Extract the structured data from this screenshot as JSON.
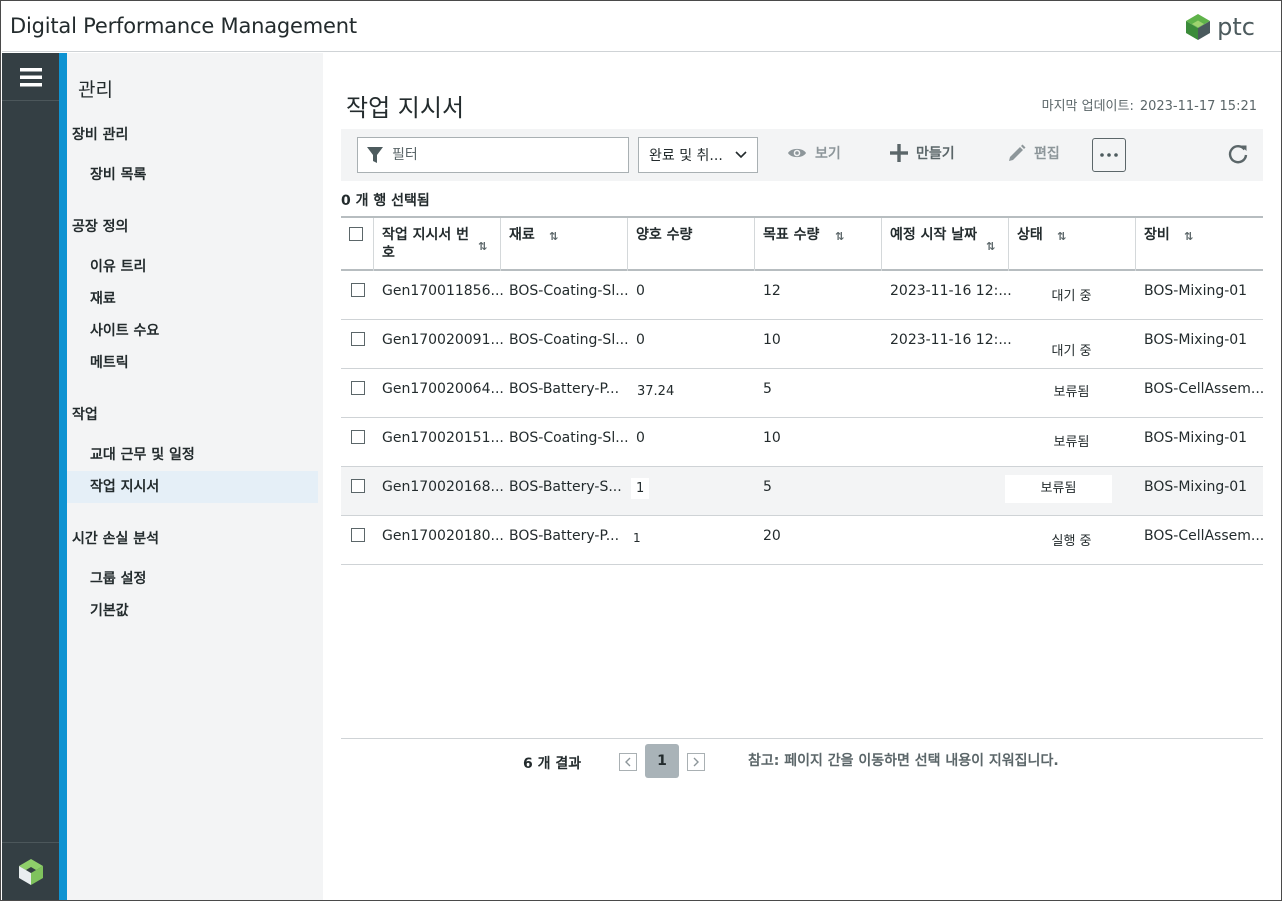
{
  "app": {
    "title": "Digital Performance Management",
    "brand": "ptc"
  },
  "sidebar": {
    "title": "관리",
    "groups": [
      {
        "label": "장비 관리",
        "items": [
          {
            "label": "장비 목록"
          }
        ]
      },
      {
        "label": "공장 정의",
        "items": [
          {
            "label": "이유 트리"
          },
          {
            "label": "재료"
          },
          {
            "label": "사이트 수요"
          },
          {
            "label": "메트릭"
          }
        ]
      },
      {
        "label": "작업",
        "items": [
          {
            "label": "교대 근무 및 일정"
          },
          {
            "label": "작업 지시서"
          }
        ]
      },
      {
        "label": "시간 손실 분석",
        "items": [
          {
            "label": "그룹 설정"
          },
          {
            "label": "기본값"
          }
        ]
      }
    ]
  },
  "page": {
    "title": "작업 지시서",
    "last_update_label": "마지막 업데이트:",
    "last_update_value": "2023-11-17 15:21"
  },
  "toolbar": {
    "filter_placeholder": "필터",
    "select_value": "완료 및 취...",
    "view_label": "보기",
    "create_label": "만들기",
    "edit_label": "편집"
  },
  "selection_text": "0 개 행 선택됨",
  "table": {
    "columns": [
      {
        "label": "작업 지시서 번호"
      },
      {
        "label": "재료"
      },
      {
        "label": "양호 수량"
      },
      {
        "label": "목표 수량"
      },
      {
        "label": "예정 시작 날짜"
      },
      {
        "label": "상태"
      },
      {
        "label": "장비"
      }
    ],
    "rows": [
      {
        "id": "Gen170011856...",
        "material": "BOS-Coating-Sl...",
        "good": "0",
        "target": "12",
        "start": "2023-11-16 12:...",
        "status": "대기 중",
        "equipment": "BOS-Mixing-01"
      },
      {
        "id": "Gen170020091...",
        "material": "BOS-Coating-Sl...",
        "good": "0",
        "target": "10",
        "start": "2023-11-16 12:...",
        "status": "대기 중",
        "equipment": "BOS-Mixing-01"
      },
      {
        "id": "Gen170020064...",
        "material": "BOS-Battery-P...",
        "good": "37.24",
        "target": "5",
        "start": "",
        "status": "보류됨",
        "equipment": "BOS-CellAssem..."
      },
      {
        "id": "Gen170020151...",
        "material": "BOS-Coating-Sl...",
        "good": "0",
        "target": "10",
        "start": "",
        "status": "보류됨",
        "equipment": "BOS-Mixing-01"
      },
      {
        "id": "Gen170020168...",
        "material": "BOS-Battery-S...",
        "good": "1",
        "target": "5",
        "start": "",
        "status": "보류됨",
        "equipment": "BOS-Mixing-01"
      },
      {
        "id": "Gen170020180...",
        "material": "BOS-Battery-P...",
        "good": "1",
        "target": "20",
        "start": "",
        "status": "실행 중",
        "equipment": "BOS-CellAssem..."
      }
    ]
  },
  "pagination": {
    "results_text": "6 개 결과",
    "current_page": "1",
    "note": "참고: 페이지 간을 이동하면 선택 내용이 지워집니다."
  },
  "colors": {
    "accent": "#0e93d2",
    "rail": "#343f44",
    "sidebar_bg": "#f3f4f5",
    "active_item": "#e5eff7"
  },
  "icons": [
    "hamburger-icon",
    "ptc-logo-icon",
    "filter-icon",
    "chevron-down-icon",
    "eye-icon",
    "plus-icon",
    "pencil-icon",
    "more-icon",
    "refresh-icon",
    "sort-icon",
    "chevron-left-icon",
    "chevron-right-icon"
  ]
}
